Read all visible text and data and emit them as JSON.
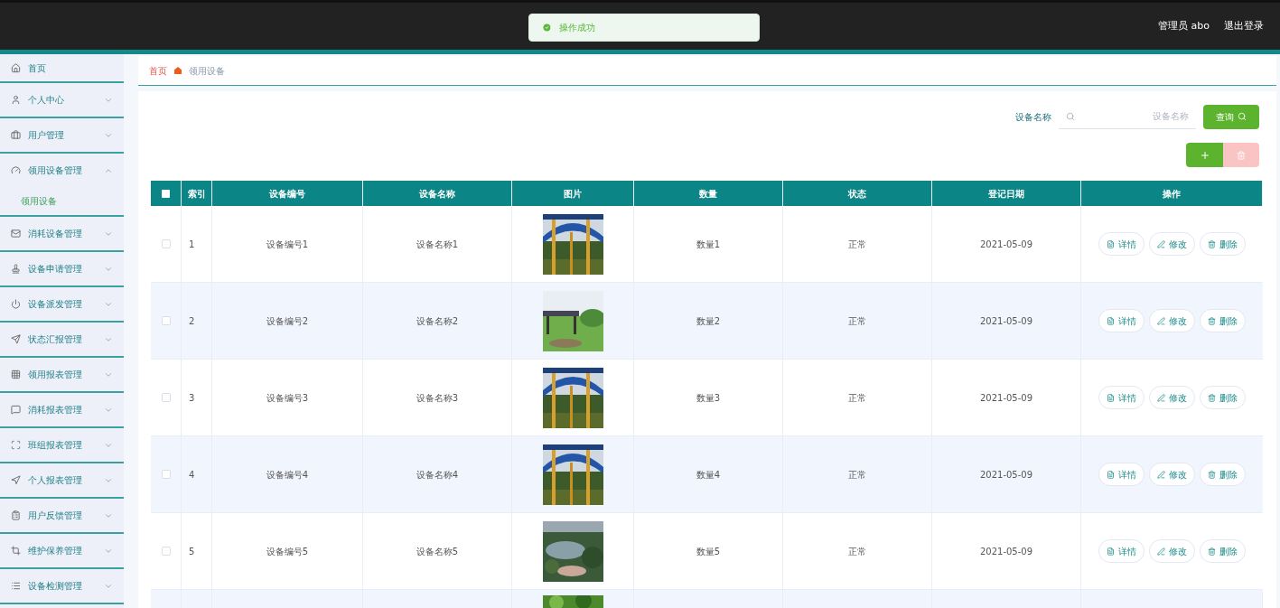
{
  "header": {
    "user": "管理员 abo",
    "logout": "退出登录"
  },
  "toast": {
    "message": "操作成功"
  },
  "sidebar": {
    "items": [
      {
        "label": "首页",
        "selected": false
      },
      {
        "label": "个人中心",
        "expanded": false,
        "selected": false
      },
      {
        "label": "用户管理",
        "expanded": false,
        "selected": false
      },
      {
        "label": "领用设备管理",
        "expanded": true,
        "selected": false,
        "children": [
          {
            "label": "领用设备",
            "selected": true
          }
        ]
      },
      {
        "label": "消耗设备管理",
        "expanded": false,
        "selected": false
      },
      {
        "label": "设备申请管理",
        "expanded": false,
        "selected": false
      },
      {
        "label": "设备派发管理",
        "expanded": false,
        "selected": false
      },
      {
        "label": "状态汇报管理",
        "expanded": false,
        "selected": false
      },
      {
        "label": "领用报表管理",
        "expanded": false,
        "selected": false
      },
      {
        "label": "消耗报表管理",
        "expanded": false,
        "selected": false
      },
      {
        "label": "班组报表管理",
        "expanded": false,
        "selected": false
      },
      {
        "label": "个人报表管理",
        "expanded": false,
        "selected": false
      },
      {
        "label": "用户反馈管理",
        "expanded": false,
        "selected": false
      },
      {
        "label": "维护保养管理",
        "expanded": false,
        "selected": false
      },
      {
        "label": "设备检测管理",
        "expanded": false,
        "selected": false
      }
    ]
  },
  "breadcrumb": [
    "首页",
    "领用设备"
  ],
  "search": {
    "label": "设备名称",
    "placeholder": "设备名称",
    "button": "查询"
  },
  "toolbar": {
    "delete_disabled": true
  },
  "table": {
    "select_all": {
      "checked": false
    },
    "columns": [
      "索引",
      "设备编号",
      "设备名称",
      "图片",
      "数量",
      "状态",
      "登记日期",
      "操作"
    ],
    "rows": [
      {
        "index": "1",
        "code": "设备编号1",
        "name": "设备名称1",
        "quantity": "数量1",
        "status": "正常",
        "date": "2021-05-09",
        "checked": false,
        "actions": [
          "详情",
          "修改",
          "删除"
        ]
      },
      {
        "index": "2",
        "code": "设备编号2",
        "name": "设备名称2",
        "quantity": "数量2",
        "status": "正常",
        "date": "2021-05-09",
        "checked": false,
        "actions": [
          "详情",
          "修改",
          "删除"
        ]
      },
      {
        "index": "3",
        "code": "设备编号3",
        "name": "设备名称3",
        "quantity": "数量3",
        "status": "正常",
        "date": "2021-05-09",
        "checked": false,
        "actions": [
          "详情",
          "修改",
          "删除"
        ]
      },
      {
        "index": "4",
        "code": "设备编号4",
        "name": "设备名称4",
        "quantity": "数量4",
        "status": "正常",
        "date": "2021-05-09",
        "checked": false,
        "actions": [
          "详情",
          "修改",
          "删除"
        ]
      },
      {
        "index": "5",
        "code": "设备编号5",
        "name": "设备名称5",
        "quantity": "数量5",
        "status": "正常",
        "date": "2021-05-09",
        "checked": false,
        "actions": [
          "详情",
          "修改",
          "删除"
        ]
      }
    ],
    "next_row_partly_visible": true
  }
}
